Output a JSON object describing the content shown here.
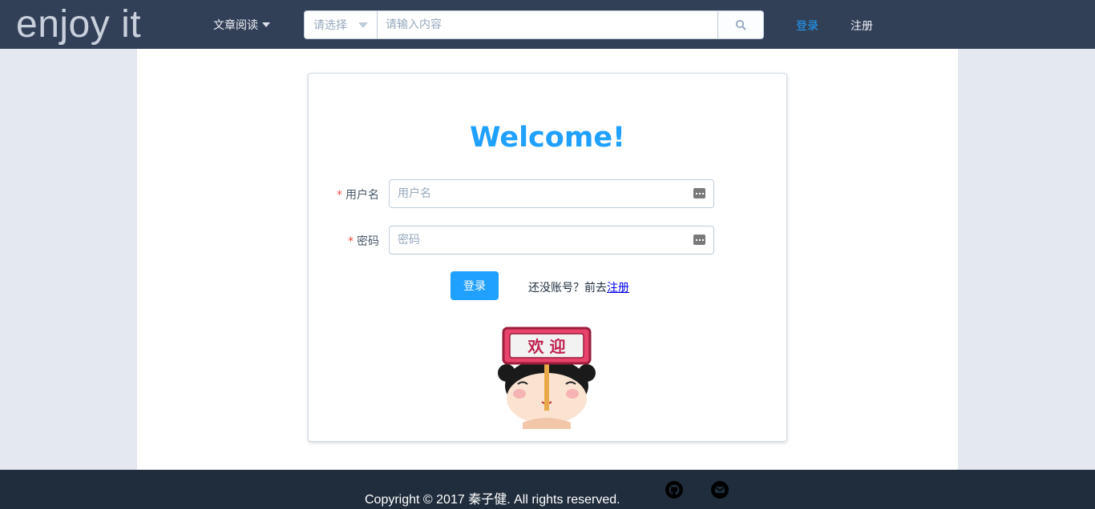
{
  "header": {
    "logo": "enjoy it",
    "menu_label": "文章阅读",
    "search": {
      "select_placeholder": "请选择",
      "input_placeholder": "请输入内容",
      "button_icon": "search-icon"
    },
    "login_link": "登录",
    "register_link": "注册"
  },
  "login_card": {
    "title": "Welcome!",
    "required_mark": "*",
    "username_label": "用户名",
    "username_placeholder": "用户名",
    "password_label": "密码",
    "password_placeholder": "密码",
    "field_icon": "keyboard-icon",
    "login_button": "登录",
    "register_hint": "还没账号？前去",
    "register_link": "注册",
    "mascot_sign_text": "欢 迎"
  },
  "footer": {
    "copyright": "Copyright © 2017 秦子健. All rights reserved.",
    "icons": [
      "github-icon",
      "mail-icon"
    ]
  },
  "colors": {
    "header_bg": "#324057",
    "footer_bg": "#1f2d3d",
    "accent": "#20a0ff",
    "page_bg": "#e4e8f1",
    "required": "#ff4949"
  }
}
